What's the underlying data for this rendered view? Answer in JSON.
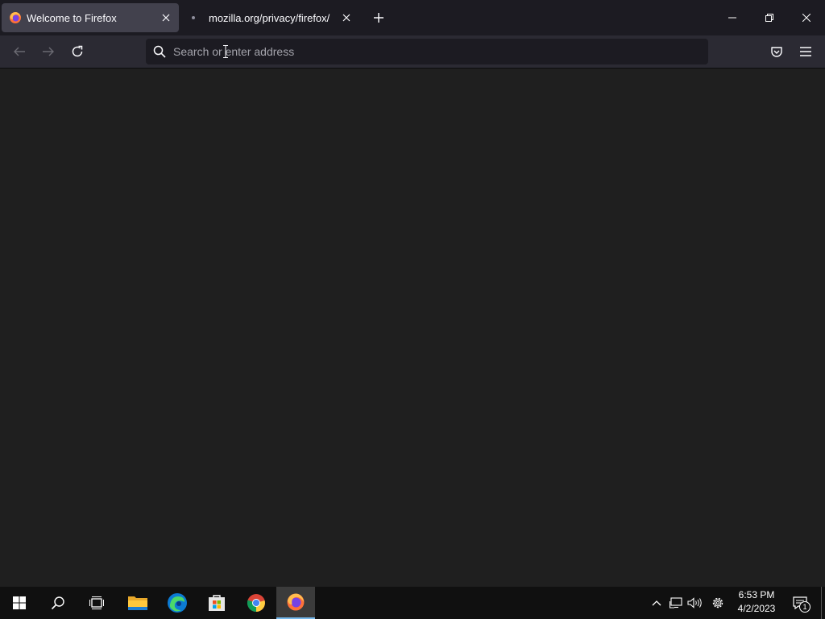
{
  "browser": {
    "tabs": [
      {
        "title": "Welcome to Firefox",
        "active": true,
        "icon": "firefox-icon"
      },
      {
        "title": "mozilla.org/privacy/firefox/",
        "active": false,
        "icon": "loading-dot-icon"
      }
    ],
    "new_tab_icon": "plus-icon",
    "window_controls": [
      "minimize-icon",
      "restore-icon",
      "close-icon"
    ],
    "nav": {
      "back_icon": "back-arrow-icon",
      "forward_icon": "forward-arrow-icon",
      "reload_icon": "reload-icon",
      "search_placeholder": "Search or enter address",
      "search_value": "",
      "pocket_icon": "pocket-icon",
      "menu_icon": "hamburger-menu-icon"
    }
  },
  "taskbar": {
    "apps": [
      "windows-start-icon",
      "search-icon",
      "task-view-icon",
      "file-explorer-icon",
      "edge-icon",
      "store-icon",
      "chrome-icon",
      "firefox-icon"
    ],
    "tray_icons": [
      "chevron-up-icon",
      "network-icon",
      "volume-icon",
      "settings-icon"
    ],
    "time": "6:53 PM",
    "date": "4/2/2023",
    "notification_count": "1"
  },
  "colors": {
    "accent": "#76b9ed",
    "tab_active_bg": "#42414d",
    "toolbar_bg": "#2b2a33",
    "content_bg": "#1f1f1f"
  }
}
